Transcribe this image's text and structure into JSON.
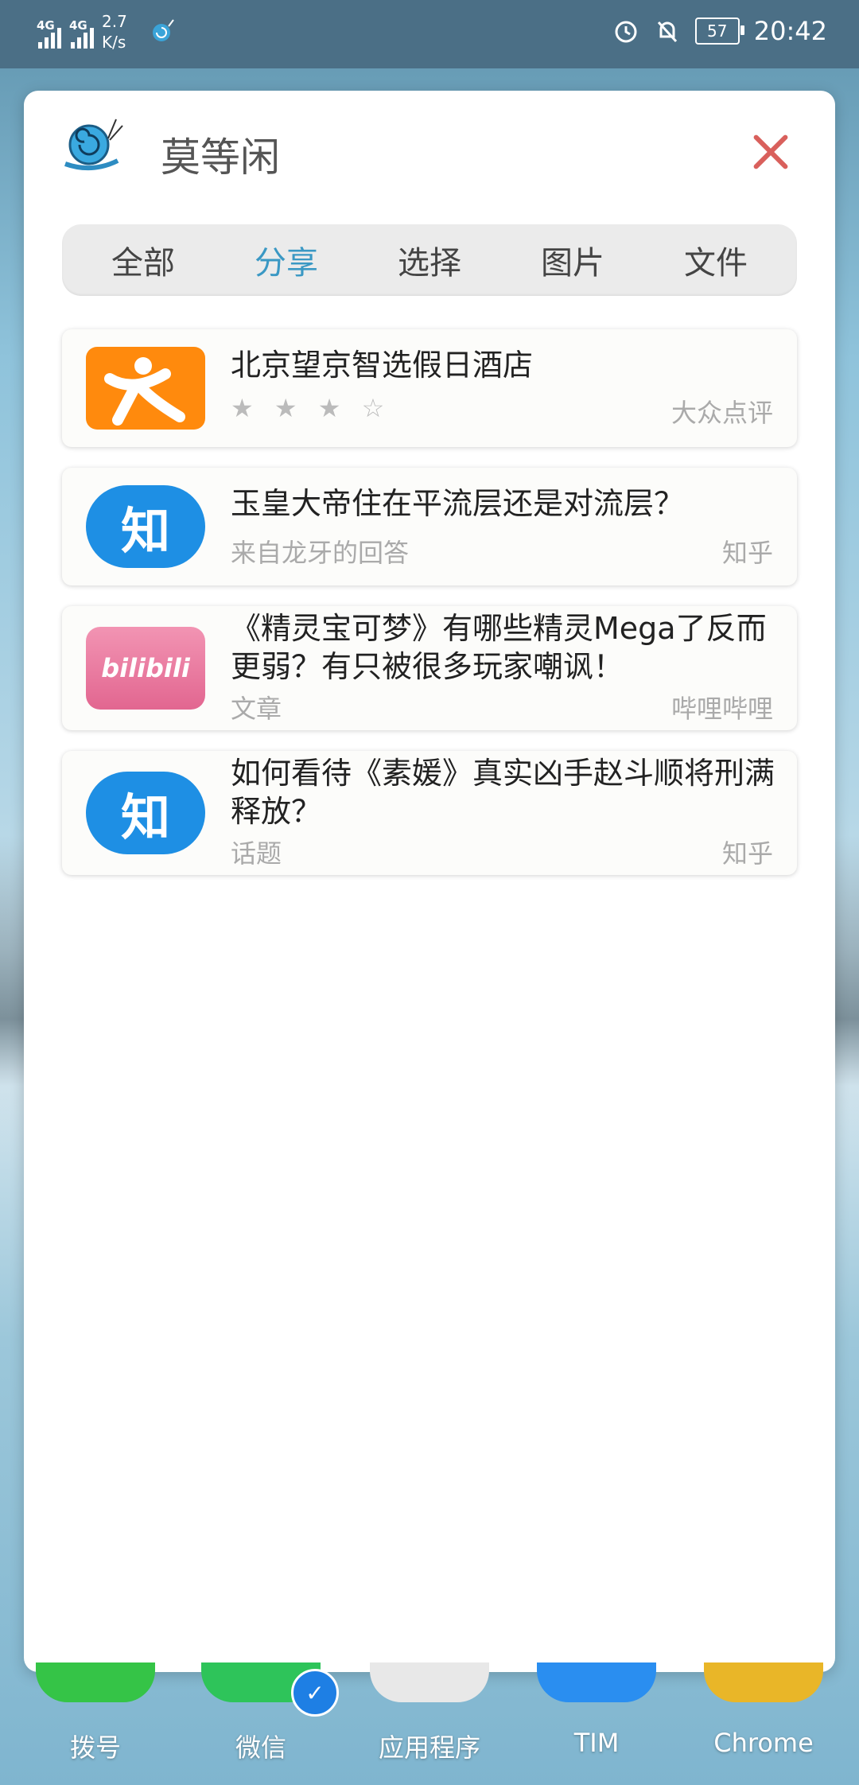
{
  "status_bar": {
    "network1": "4G",
    "network2": "4G",
    "speed_value": "2.7",
    "speed_unit": "K/s",
    "battery": "57",
    "time": "20:42"
  },
  "panel": {
    "title": "莫等闲",
    "tabs": [
      {
        "label": "全部",
        "active": false
      },
      {
        "label": "分享",
        "active": true
      },
      {
        "label": "选择",
        "active": false
      },
      {
        "label": "图片",
        "active": false
      },
      {
        "label": "文件",
        "active": false
      }
    ],
    "items": [
      {
        "title": "北京望京智选假日酒店",
        "subtitle": "★ ★ ★ ☆",
        "source": "大众点评",
        "icon": "dianping-icon"
      },
      {
        "title": "玉皇大帝住在平流层还是对流层？",
        "subtitle": "来自龙牙的回答",
        "source": "知乎",
        "icon": "zhihu-icon",
        "icon_text": "知"
      },
      {
        "title": "《精灵宝可梦》有哪些精灵Mega了反而更弱？有只被很多玩家嘲讽！",
        "subtitle": "文章",
        "source": "哔哩哔哩",
        "icon": "bilibili-icon",
        "icon_text": "bilibili"
      },
      {
        "title": "如何看待《素媛》真实凶手赵斗顺将刑满释放？",
        "subtitle": "话题",
        "source": "知乎",
        "icon": "zhihu-icon",
        "icon_text": "知"
      }
    ]
  },
  "dock": [
    {
      "label": "拨号",
      "color": "#35c447"
    },
    {
      "label": "微信",
      "color": "#2ec45a"
    },
    {
      "label": "应用程序",
      "color": "#e8e8e8"
    },
    {
      "label": "TIM",
      "color": "#2a8ef0"
    },
    {
      "label": "Chrome",
      "color": "#e9b628"
    }
  ],
  "colors": {
    "accent": "#3a98c4",
    "close": "#d9605c",
    "zhihu": "#1e8fe4",
    "dianping": "#ff8a0d",
    "bilibili": "#e97a9f"
  }
}
